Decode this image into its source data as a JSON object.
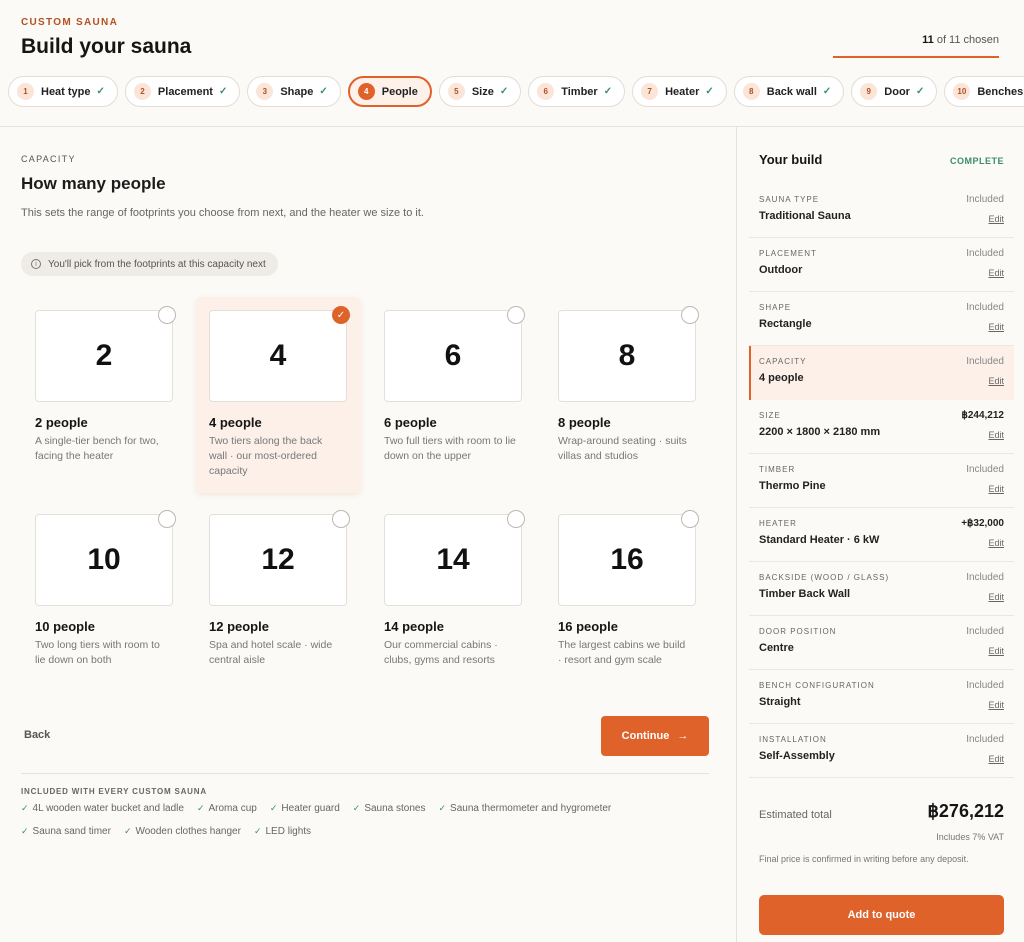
{
  "header": {
    "eyebrow": "CUSTOM SAUNA",
    "title": "Build your sauna",
    "progress_count": "11",
    "progress_rest": " of 11 chosen",
    "progress_fraction": 1.0
  },
  "steps": [
    {
      "num": "1",
      "label": "Heat type",
      "done": true
    },
    {
      "num": "2",
      "label": "Placement",
      "done": true
    },
    {
      "num": "3",
      "label": "Shape",
      "done": true
    },
    {
      "num": "4",
      "label": "People",
      "done": false,
      "active": true
    },
    {
      "num": "5",
      "label": "Size",
      "done": true
    },
    {
      "num": "6",
      "label": "Timber",
      "done": true
    },
    {
      "num": "7",
      "label": "Heater",
      "done": true
    },
    {
      "num": "8",
      "label": "Back wall",
      "done": true
    },
    {
      "num": "9",
      "label": "Door",
      "done": true
    },
    {
      "num": "10",
      "label": "Benches",
      "done": true
    }
  ],
  "section": {
    "eyebrow": "CAPACITY",
    "title": "How many people",
    "description": "This sets the range of footprints you choose from next, and the heater we size to it.",
    "hint": "You'll pick from the footprints at this capacity next"
  },
  "options": [
    {
      "number": "2",
      "title": "2 people",
      "desc": "A single-tier bench for two, facing the heater",
      "selected": false
    },
    {
      "number": "4",
      "title": "4 people",
      "desc": "Two tiers along the back wall · our most-ordered capacity",
      "selected": true
    },
    {
      "number": "6",
      "title": "6 people",
      "desc": "Two full tiers with room to lie down on the upper",
      "selected": false
    },
    {
      "number": "8",
      "title": "8 people",
      "desc": "Wrap-around seating · suits villas and studios",
      "selected": false
    },
    {
      "number": "10",
      "title": "10 people",
      "desc": "Two long tiers with room to lie down on both",
      "selected": false
    },
    {
      "number": "12",
      "title": "12 people",
      "desc": "Spa and hotel scale · wide central aisle",
      "selected": false
    },
    {
      "number": "14",
      "title": "14 people",
      "desc": "Our commercial cabins · clubs, gyms and resorts",
      "selected": false
    },
    {
      "number": "16",
      "title": "16 people",
      "desc": "The largest cabins we build · resort and gym scale",
      "selected": false
    }
  ],
  "nav": {
    "back": "Back",
    "continue": "Continue",
    "continue_arrow": "→"
  },
  "included": {
    "title": "INCLUDED WITH EVERY CUSTOM SAUNA",
    "items": [
      "4L wooden water bucket and ladle",
      "Aroma cup",
      "Heater guard",
      "Sauna stones",
      "Sauna thermometer and hygrometer",
      "Sauna sand timer",
      "Wooden clothes hanger",
      "LED lights"
    ]
  },
  "summary": {
    "title": "Your build",
    "status": "COMPLETE",
    "edit_label": "Edit",
    "rows": [
      {
        "label": "SAUNA TYPE",
        "value": "Traditional Sauna",
        "price": "Included"
      },
      {
        "label": "PLACEMENT",
        "value": "Outdoor",
        "price": "Included"
      },
      {
        "label": "SHAPE",
        "value": "Rectangle",
        "price": "Included"
      },
      {
        "label": "CAPACITY",
        "value": "4 people",
        "price": "Included",
        "current": true
      },
      {
        "label": "SIZE",
        "value": "2200 × 1800 × 2180 mm",
        "price": "฿244,212",
        "amount": true
      },
      {
        "label": "TIMBER",
        "value": "Thermo Pine",
        "price": "Included"
      },
      {
        "label": "HEATER",
        "value": "Standard Heater · 6 kW",
        "price": "+฿32,000",
        "amount": true
      },
      {
        "label": "BACKSIDE (WOOD / GLASS)",
        "value": "Timber Back Wall",
        "price": "Included"
      },
      {
        "label": "DOOR POSITION",
        "value": "Centre",
        "price": "Included"
      },
      {
        "label": "BENCH CONFIGURATION",
        "value": "Straight",
        "price": "Included"
      },
      {
        "label": "INSTALLATION",
        "value": "Self-Assembly",
        "price": "Included"
      }
    ],
    "total_label": "Estimated total",
    "total_value": "฿276,212",
    "vat_note": "Includes 7% VAT",
    "final_note": "Final price is confirmed in writing before any deposit.",
    "add_button": "Add to quote"
  },
  "colors": {
    "accent": "#e0622b",
    "accent_soft": "#fdf0e8",
    "success": "#3c8d6a"
  }
}
